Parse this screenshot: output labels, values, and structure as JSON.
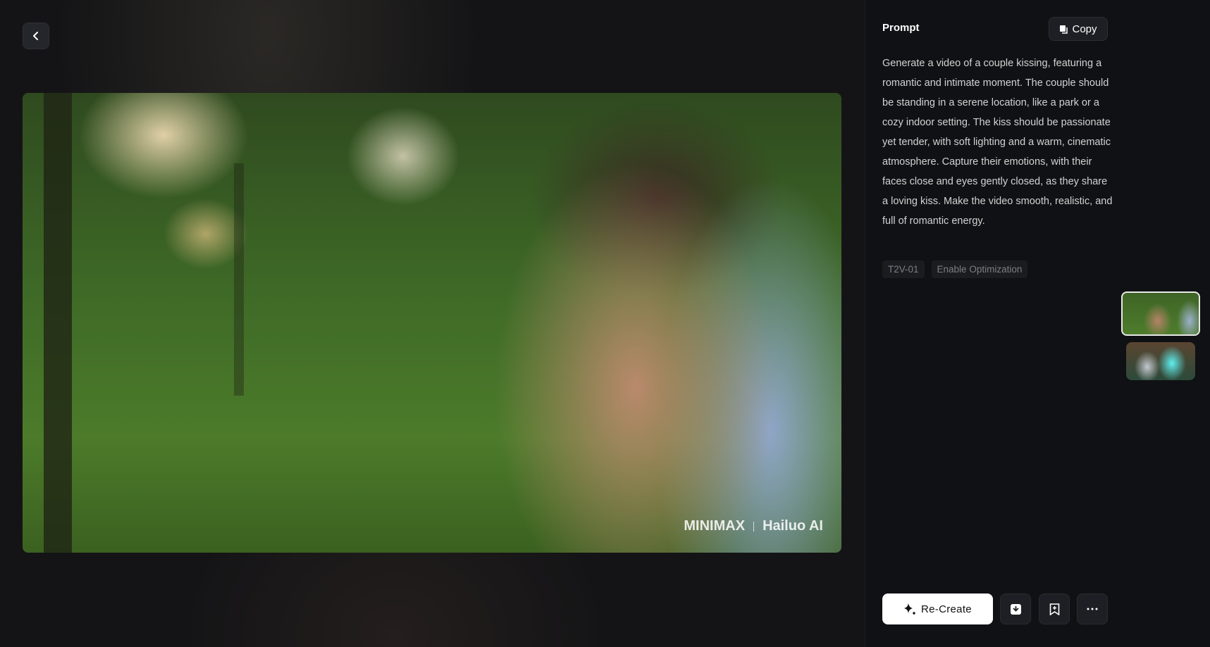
{
  "nav": {
    "back_icon": "chevron-left-icon"
  },
  "video": {
    "watermark": {
      "brand1": "MINIMAX",
      "brand2": "Hailuo AI"
    }
  },
  "panel": {
    "title": "Prompt",
    "copy_label": "Copy",
    "prompt_text": "Generate a video of a couple kissing, featuring a romantic and intimate moment. The couple should be standing in a serene location, like a park or a cozy indoor setting. The kiss should be passionate yet tender, with soft lighting and a warm, cinematic atmosphere. Capture their emotions, with their faces close and eyes gently closed, as they share a loving kiss. Make the video smooth, realistic, and full of romantic energy.",
    "tags": [
      "T2V-01",
      "Enable Optimization"
    ]
  },
  "actions": {
    "recreate_label": "Re-Create",
    "download_icon": "download-icon",
    "bookmark_icon": "bookmark-add-icon",
    "more_icon": "more-icon"
  }
}
